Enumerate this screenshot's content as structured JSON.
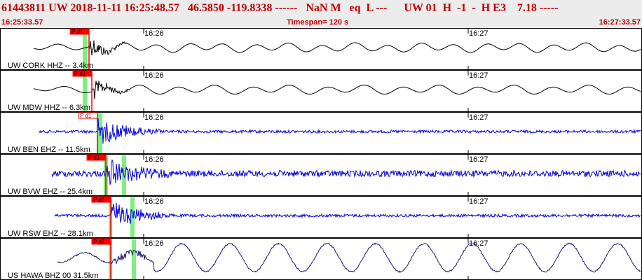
{
  "header": {
    "title": "61443811 UW 2018-11-11 16:25:48.57   46.5850 -119.8338 ------   NaN M   eq  L ---      UW 01  H  -1  -  H E3    7.18 -----",
    "start_time": "16:25:33.57",
    "timespan": "Timespan= 120 s",
    "end_time": "16:27:33.57"
  },
  "colors": {
    "header_text": "#c00000",
    "header_bg": "#ececec",
    "pick_red": "#ff0000",
    "pick_window": "#7ef07e",
    "trace_black": "#000000",
    "trace_blue": "#0000dd",
    "trace_navy": "#1a1a70",
    "border": "#000000"
  },
  "time_marks": [
    "16:26",
    "16:27"
  ],
  "traces": [
    {
      "label": "UW CORK HHZ -- 3.4km",
      "color": "#000000",
      "type": "long",
      "pick": "P d1",
      "pick_style": "filled"
    },
    {
      "label": "UW MDW HHZ -- 6.3km",
      "color": "#000000",
      "type": "long",
      "pick": "P d1",
      "pick_style": "filled"
    },
    {
      "label": "UW BEN EHZ -- 11.5km",
      "color": "#0000dd",
      "type": "short",
      "pick": "P d1",
      "pick_style": "outline"
    },
    {
      "label": "UW BVW EHZ -- 25.4km",
      "color": "#0000dd",
      "type": "short",
      "pick": "P d1",
      "pick_style": "filled"
    },
    {
      "label": "UW RSW EHZ -- 28.1km",
      "color": "#0000dd",
      "type": "short",
      "pick": "P d1",
      "pick_style": "filled"
    },
    {
      "label": "US HAWA BHZ 00 31.5km",
      "color": "#1a1a70",
      "type": "surface",
      "pick": "P d1",
      "pick_style": "filled"
    }
  ]
}
